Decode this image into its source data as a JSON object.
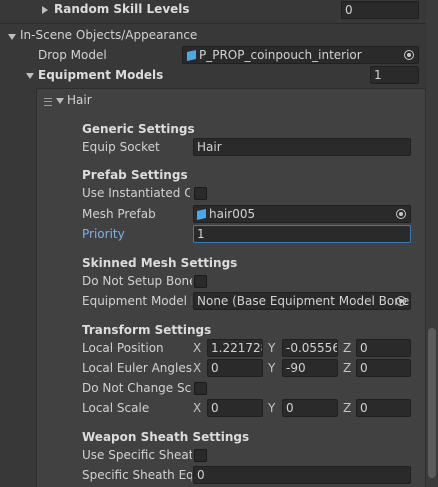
{
  "random_skill_levels": {
    "label": "Random Skill Levels",
    "value": "0"
  },
  "in_scene": {
    "label": "In-Scene Objects/Appearance"
  },
  "drop_model": {
    "label": "Drop Model",
    "value": "P_PROP_coinpouch_interior"
  },
  "equipment_models": {
    "label": "Equipment Models",
    "count": "1"
  },
  "hair": {
    "label": "Hair"
  },
  "generic": {
    "heading": "Generic Settings",
    "equip_socket_label": "Equip Socket",
    "equip_socket_value": "Hair"
  },
  "prefab": {
    "heading": "Prefab Settings",
    "use_instantiated_label": "Use Instantiated Ob",
    "mesh_prefab_label": "Mesh Prefab",
    "mesh_prefab_value": "hair005",
    "priority_label": "Priority",
    "priority_value": "1"
  },
  "skinned": {
    "heading": "Skinned Mesh Settings",
    "do_not_setup_label": "Do Not Setup Bones",
    "equipment_model_label": "Equipment Model Bo",
    "equipment_model_value": "None (Base Equipment Model Bone"
  },
  "transform": {
    "heading": "Transform Settings",
    "local_position_label": "Local Position",
    "local_position": {
      "x": "1.221728",
      "y": "-0.05556",
      "z": "0"
    },
    "local_euler_label": "Local Euler Angles",
    "local_euler": {
      "x": "0",
      "y": "-90",
      "z": "0"
    },
    "do_not_change_label": "Do Not Change Sca",
    "local_scale_label": "Local Scale",
    "local_scale": {
      "x": "0",
      "y": "0",
      "z": "0"
    },
    "axis_x": "X",
    "axis_y": "Y",
    "axis_z": "Z"
  },
  "weapon_sheath": {
    "heading": "Weapon Sheath Settings",
    "use_specific_label": "Use Specific Sheatl",
    "specific_equip_label": "Specific Sheath Equ",
    "specific_equip_value": "0"
  },
  "colors": {
    "background": "#383838",
    "panel": "#414141",
    "field": "#2a2a2a",
    "accent": "#3a79bb",
    "priority_label": "#7fb0e8"
  }
}
